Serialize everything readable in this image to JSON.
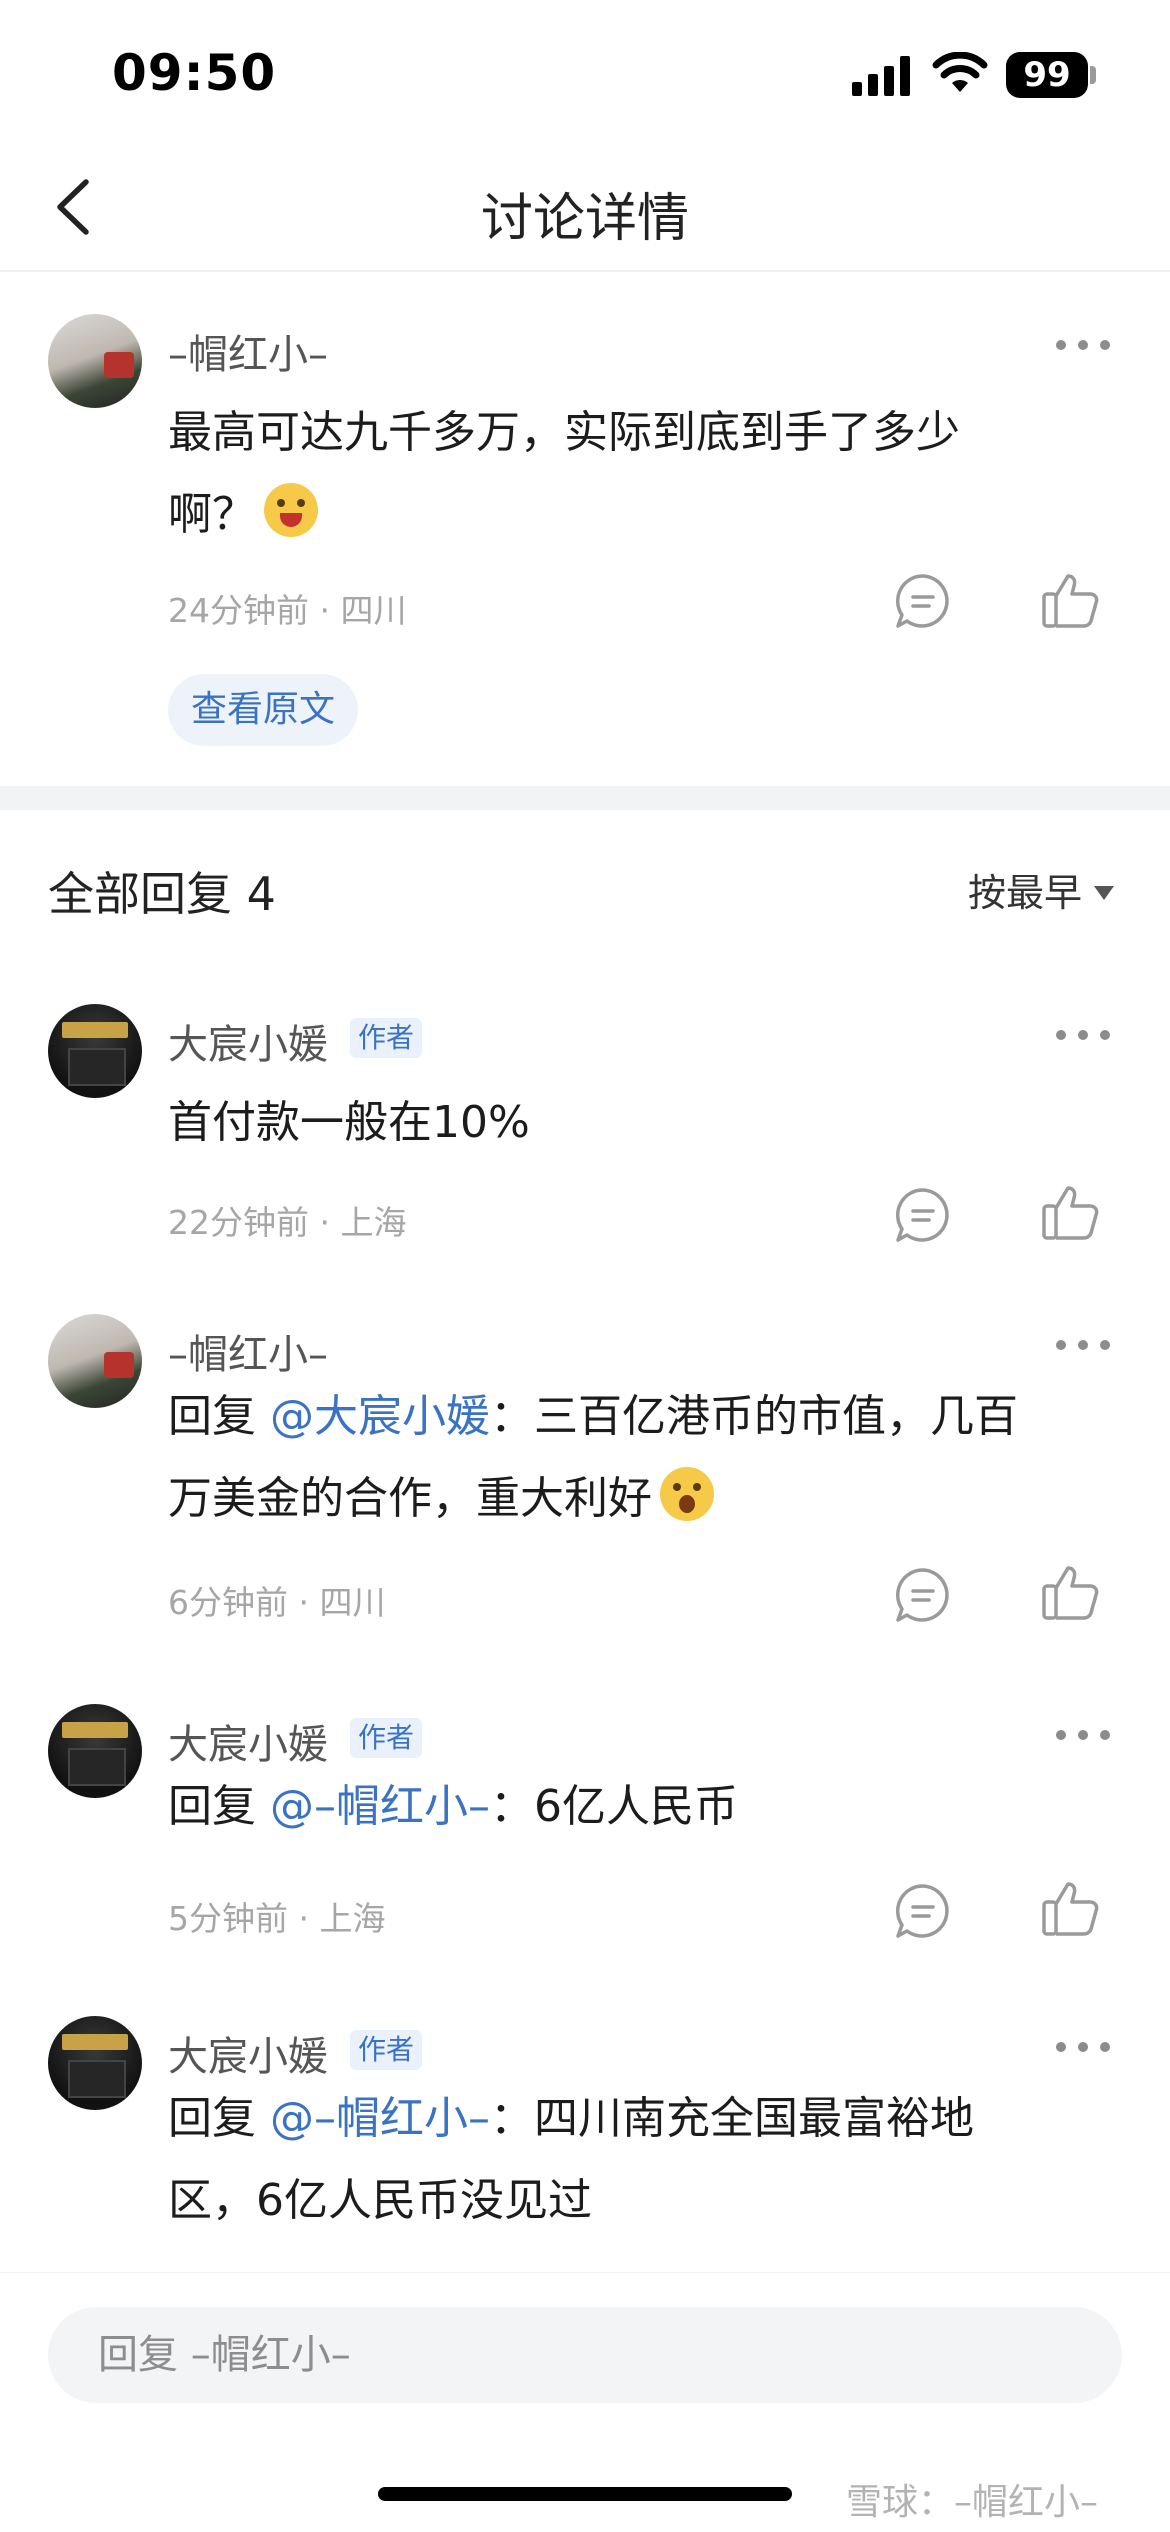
{
  "status_bar": {
    "time": "09:50",
    "battery": "99"
  },
  "nav": {
    "title": "讨论详情"
  },
  "post": {
    "username": "–帽红小–",
    "text_line1": "最高可达九千多万，实际到底到手了多少",
    "text_line2": "啊？",
    "meta": "24分钟前 · 四川",
    "view_original": "查看原文"
  },
  "replies_header": {
    "title": "全部回复 4",
    "sort_label": "按最早"
  },
  "replies": [
    {
      "username": "大宸小媛",
      "tag": "作者",
      "text": "首付款一般在10%",
      "meta": "22分钟前 · 上海"
    },
    {
      "username": "–帽红小–",
      "prefix": "回复 ",
      "mention": "@大宸小媛",
      "text_line1": "：三百亿港币的市值，几百",
      "text_line2": "万美金的合作，重大利好",
      "meta": "6分钟前 · 四川"
    },
    {
      "username": "大宸小媛",
      "tag": "作者",
      "prefix": "回复 ",
      "mention": "@–帽红小–",
      "text": "：6亿人民币",
      "meta": "5分钟前 · 上海"
    },
    {
      "username": "大宸小媛",
      "tag": "作者",
      "prefix": "回复 ",
      "mention": "@–帽红小–",
      "text_line1": "：四川南充全国最富裕地",
      "text_line2": "区，6亿人民币没见过"
    }
  ],
  "input": {
    "placeholder": "回复 –帽红小–"
  },
  "watermark": "雪球：–帽红小–"
}
